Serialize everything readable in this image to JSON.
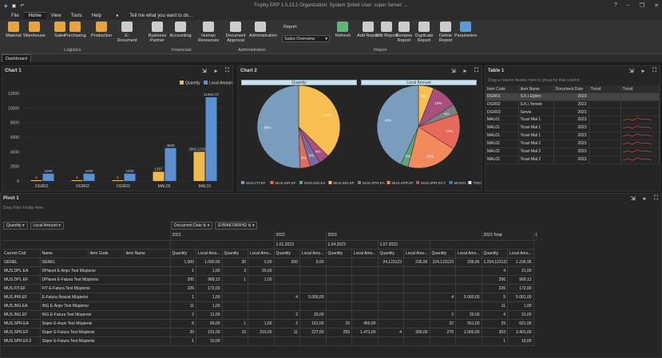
{
  "app": {
    "title": "Trophy ERP 1.0.13.1  Organization: System Şirketi  User: super  Server: ..."
  },
  "menu": [
    "File",
    "Home",
    "View",
    "Tools",
    "Help"
  ],
  "tell_me": "Tell me what you want to do...",
  "ribbon": {
    "buttons": [
      {
        "label": "Material",
        "icon": "material-icon",
        "color": "#e8a33d"
      },
      {
        "label": "Warehouse",
        "icon": "warehouse-icon",
        "color": "#e8a33d"
      },
      {
        "label": "Sales",
        "icon": "sales-icon",
        "color": "#e8a33d"
      },
      {
        "label": "Purchasing",
        "icon": "purchasing-icon",
        "color": "#e8a33d"
      },
      {
        "label": "Production",
        "icon": "production-icon",
        "color": "#e8a33d"
      },
      {
        "label": "E-Document",
        "icon": "edocument-icon",
        "color": "#cccccc"
      },
      {
        "label": "Business Partner",
        "icon": "business-partner-icon",
        "color": "#cccccc"
      },
      {
        "label": "Accounting",
        "icon": "accounting-icon",
        "color": "#cccccc"
      },
      {
        "label": "Human Resources",
        "icon": "human-resources-icon",
        "color": "#cccccc"
      },
      {
        "label": "Document Approval",
        "icon": "document-approval-icon",
        "color": "#cccccc"
      },
      {
        "label": "Administration",
        "icon": "administration-icon",
        "color": "#cccccc"
      },
      {
        "label": "Refresh",
        "icon": "refresh-icon",
        "color": "#5fb878"
      },
      {
        "label": "Add Report",
        "icon": "add-report-icon",
        "color": "#cccccc"
      },
      {
        "label": "Edit Report",
        "icon": "edit-report-icon",
        "color": "#cccccc"
      },
      {
        "label": "Rename Report",
        "icon": "rename-report-icon",
        "color": "#cccccc"
      },
      {
        "label": "Duplicate Report",
        "icon": "duplicate-report-icon",
        "color": "#cccccc"
      },
      {
        "label": "Delete Report",
        "icon": "delete-report-icon",
        "color": "#cccccc"
      },
      {
        "label": "Parameters",
        "icon": "parameters-icon",
        "color": "#5b9bd5"
      }
    ],
    "groups": [
      "Logistics",
      "Financials",
      "Administration",
      "Report"
    ],
    "report_label": "Report",
    "report_select": "Sales Overview"
  },
  "tab": "Dashboard",
  "chart1": {
    "title": "Chart 1"
  },
  "chart2": {
    "title": "Chart 2",
    "pie1_title": "Quantity",
    "pie2_title": "Local Amount"
  },
  "table1": {
    "title": "Table 1",
    "group_hint": "Drag a column header here to group by that column",
    "columns": [
      "Item Code",
      "Item Name",
      "Document Date",
      "Trend",
      "Trend"
    ],
    "rows": [
      [
        "DGR01",
        "S.K.I.Eğitim",
        "2023"
      ],
      [
        "DGR02",
        "S.K.I.Yemek",
        "2023"
      ],
      [
        "DGR03",
        "Servis",
        "2023"
      ],
      [
        "MAL01",
        "Ticari Mal 1",
        "2023"
      ],
      [
        "MAL01",
        "Ticari Mal 1",
        "2023"
      ],
      [
        "MAL01",
        "Ticari Mal 1",
        "2023"
      ],
      [
        "MAL02",
        "Ticari Mal 2",
        "2023"
      ],
      [
        "MAL02",
        "Ticari Mal 2",
        "2023"
      ],
      [
        "MAL02",
        "Ticari Mal 2",
        "2023"
      ]
    ]
  },
  "pivot": {
    "title": "Pivot 1",
    "filter_hint": "Drop Filter Fields Here",
    "data_fields": [
      "Quantity",
      "Local Amount"
    ],
    "col_fields": [
      "Document Date",
      "EVRAKTARIHI2"
    ],
    "row_fields": [
      "Current Cod",
      "Name",
      "Item Code",
      "Item Name"
    ],
    "years": [
      "2021",
      "2022",
      "2023",
      "2023 Total",
      "Grand Total"
    ],
    "months": [
      "1.01.2023",
      "1.04.2023",
      "1.07.2023"
    ],
    "measure_headers": [
      "Quantity",
      "Local Amo..."
    ],
    "rows": [
      {
        "code": "GENEL",
        "name": "GENEL",
        "v": [
          "1,000",
          "1.000,00",
          "30",
          "0,00",
          "200",
          "0,00",
          "",
          "",
          "24,123123",
          "236,95",
          "224,123123",
          "236,95",
          "1.254,123123",
          "1.236,95"
        ]
      },
      {
        "code": "MUS.DPL.EA",
        "name": "DPlanet E-Arşiv Test Müşterisi",
        "v": [
          "1",
          "1,00",
          "3",
          "20,00",
          "",
          "",
          "",
          "",
          "",
          "",
          "",
          "",
          "4",
          "21,00"
        ]
      },
      {
        "code": "MUS.DPL.EF",
        "name": "DPlanet E-Fatura Test Müşterisi",
        "v": [
          "295",
          "968,12",
          "1",
          "1,00",
          "",
          "",
          "",
          "",
          "",
          "",
          "",
          "",
          "296",
          "969,12"
        ]
      },
      {
        "code": "MUS.FIT.EF",
        "name": "FIT E-Fatura Test Müşterisi",
        "v": [
          "226",
          "172,00",
          "",
          "",
          "",
          "",
          "",
          "",
          "",
          "",
          "",
          "",
          "226",
          "172,00"
        ]
      },
      {
        "code": "MUS.IHR.EF",
        "name": "E-Fatura İhracat Müşterisi",
        "v": [
          "1",
          "1,00",
          "",
          "",
          "4",
          "5.000,00",
          "",
          "",
          "",
          "",
          "4",
          "5.000,00",
          "5",
          "5.001,00"
        ]
      },
      {
        "code": "MUS.ING.EA",
        "name": "ING E-Arşiv Test Müşterisi",
        "v": [
          "11",
          "1,00",
          "",
          "",
          "",
          "",
          "",
          "",
          "",
          "",
          "",
          "",
          "11",
          "1,00"
        ]
      },
      {
        "code": "MUS.ING.EF",
        "name": "ING E-Fatura Test Müşterisi",
        "v": [
          "2",
          "11,00",
          "",
          "",
          "2",
          "20,00",
          "",
          "",
          "",
          "",
          "2",
          "20,00",
          "4",
          "31,00"
        ]
      },
      {
        "code": "MUS.SPR.EA",
        "name": "Süper E-Arşiv Test Müşterisi",
        "v": [
          "6",
          "69,00",
          "1",
          "1,00",
          "2",
          "101,00",
          "20",
          "450,00",
          "",
          "",
          "22",
          "551,00",
          "29",
          "621,00"
        ]
      },
      {
        "code": "MUS.SPR.EF",
        "name": "Süper E-Fatura Test Müşterisi",
        "v": [
          "20",
          "191,00",
          "15",
          "210,00",
          "11",
          "227,00",
          "255",
          "1.473,00",
          "4",
          "300,00",
          "270",
          "2.000,00",
          "303",
          "2.401,00"
        ]
      },
      {
        "code": "MUS.SPR.EF.2",
        "name": "Süper E-Fatura Test Müşterisi",
        "v": [
          "1",
          "10,00",
          "",
          "",
          "",
          "",
          "",
          "",
          "",
          "",
          "",
          "",
          "1",
          "10,00"
        ]
      }
    ]
  },
  "chart_data": [
    {
      "type": "bar",
      "title": "",
      "categories": [
        "DGR01",
        "DGR02",
        "DGR03",
        "MAL02",
        "MAL01"
      ],
      "xlabel": "Item Code",
      "ylabel": "",
      "ylim": [
        0,
        12000
      ],
      "yticks": [
        "0",
        "2000",
        "4000",
        "6000",
        "8000",
        "10000",
        "12000"
      ],
      "series": [
        {
          "name": "Quantity",
          "color": "#f0b94d",
          "values": [
            1,
            1,
            1,
            1257,
            3983.123123
          ],
          "labels": [
            "1",
            "1",
            "1",
            "1257",
            "3983,123123"
          ]
        },
        {
          "name": "Local Amount",
          "color": "#5b8fd1",
          "values": [
            1000,
            1000,
            1000,
            4500,
            11454.72
          ],
          "labels": [
            "1000",
            "1000",
            "1000",
            "4500",
            "11454,72"
          ]
        }
      ],
      "legend": "top-right"
    },
    {
      "type": "pie",
      "title": "Quantity",
      "slices": [
        {
          "name": "MUS.FIT.EF",
          "value": 37,
          "color": "#f8be52"
        },
        {
          "name": "MUS.IHR.EF",
          "value": 4,
          "color": "#a94f7d"
        },
        {
          "name": "MUS.SPR.EF",
          "value": 4,
          "color": "#7a6aa3"
        },
        {
          "name": "MUS.SPR.EF.2",
          "value": 4,
          "color": "#e06c5a"
        },
        {
          "name": "MUS01",
          "value": 50,
          "color": "#7a9cbd"
        }
      ],
      "labels": [
        "37%",
        "4%",
        "4%",
        "4%",
        "50%"
      ]
    },
    {
      "type": "pie",
      "title": "Local Amount",
      "slices": [
        {
          "name": "MUS.FIT.EF",
          "value": 6,
          "color": "#f8be52"
        },
        {
          "name": "MUS.IHR.EF",
          "value": 10,
          "color": "#a94f7d"
        },
        {
          "name": "MUS.ING.EF",
          "value": 4,
          "color": "#7f7f7f"
        },
        {
          "name": "MUS.SPR.EF",
          "value": 14,
          "color": "#e56a5b"
        },
        {
          "name": "MUS.SPR.EF.2",
          "value": 20,
          "color": "#f28a5c"
        },
        {
          "name": "MUS.ING.EA",
          "value": 3,
          "color": "#5fa37a"
        },
        {
          "name": "MUS01",
          "value": 43,
          "color": "#7a9cbd"
        }
      ],
      "labels": [
        "6%",
        "10%",
        "4%",
        "14%",
        "20%",
        "3%",
        "43%"
      ]
    }
  ],
  "pie_legend": [
    {
      "name": "MUS.FIT.EF",
      "color": "#7a9cbd"
    },
    {
      "name": "MUS.IHR.EF",
      "color": "#e56a5b"
    },
    {
      "name": "MUS.ING.EA",
      "color": "#5fa37a"
    },
    {
      "name": "MUS.ING.EF",
      "color": "#f8be52"
    },
    {
      "name": "MUS.SPR.EA",
      "color": "#7f7f7f"
    },
    {
      "name": "MUS.SPR.EF",
      "color": "#f28a5c"
    },
    {
      "name": "MUS.SPR.EF.2",
      "color": "#a94f7d"
    },
    {
      "name": "MUS01",
      "color": "#4e78b5"
    },
    {
      "name": "TED01",
      "color": "#cfe0f5"
    }
  ]
}
